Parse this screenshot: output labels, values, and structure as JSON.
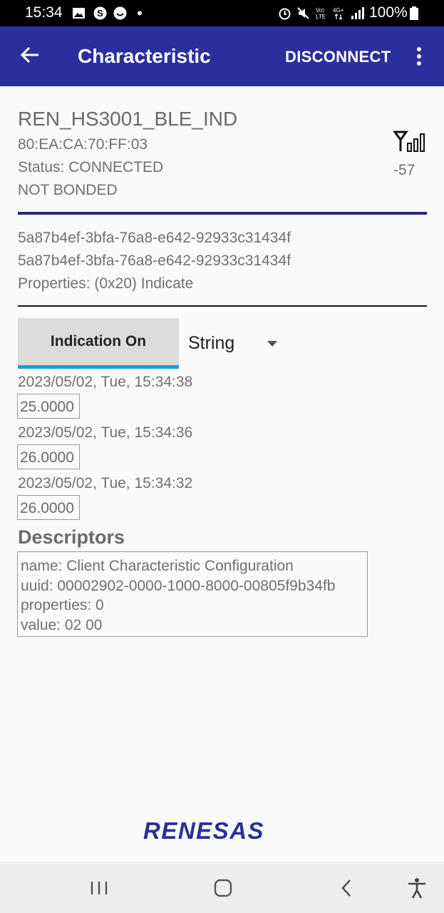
{
  "status_bar": {
    "time": "15:34",
    "battery": "100%",
    "icons_left": [
      "gallery-icon",
      "s-icon",
      "smile-icon",
      "dot-icon"
    ],
    "icons_right": [
      "alarm-icon",
      "mute-icon",
      "volte-icon",
      "4g-icon",
      "signal-icon",
      "battery-icon"
    ]
  },
  "app_bar": {
    "title": "Characteristic",
    "action": "DISCONNECT",
    "colors": {
      "bar": "#2a2f9d"
    }
  },
  "device": {
    "name": "REN_HS3001_BLE_IND",
    "address": "80:EA:CA:70:FF:03",
    "status": "Status:  CONNECTED",
    "bond": "NOT BONDED",
    "rssi": "-57"
  },
  "characteristic": {
    "service_uuid": "5a87b4ef-3bfa-76a8-e642-92933c31434f",
    "char_uuid": "5a87b4ef-3bfa-76a8-e642-92933c31434f",
    "properties": "Properties: (0x20) Indicate"
  },
  "controls": {
    "indication_button": "Indication On",
    "format_selected": "String"
  },
  "readings": [
    {
      "timestamp": "2023/05/02, Tue, 15:34:38",
      "value": "25.0000"
    },
    {
      "timestamp": "2023/05/02, Tue, 15:34:36",
      "value": "26.0000"
    },
    {
      "timestamp": "2023/05/02, Tue, 15:34:32",
      "value": "26.0000"
    }
  ],
  "descriptors": {
    "title": "Descriptors",
    "lines": [
      "name: Client Characteristic Configuration",
      "uuid: 00002902-0000-1000-8000-00805f9b34fb",
      "properties: 0",
      "value: 02 00"
    ]
  },
  "footer": {
    "logo_text": "RENESAS"
  }
}
